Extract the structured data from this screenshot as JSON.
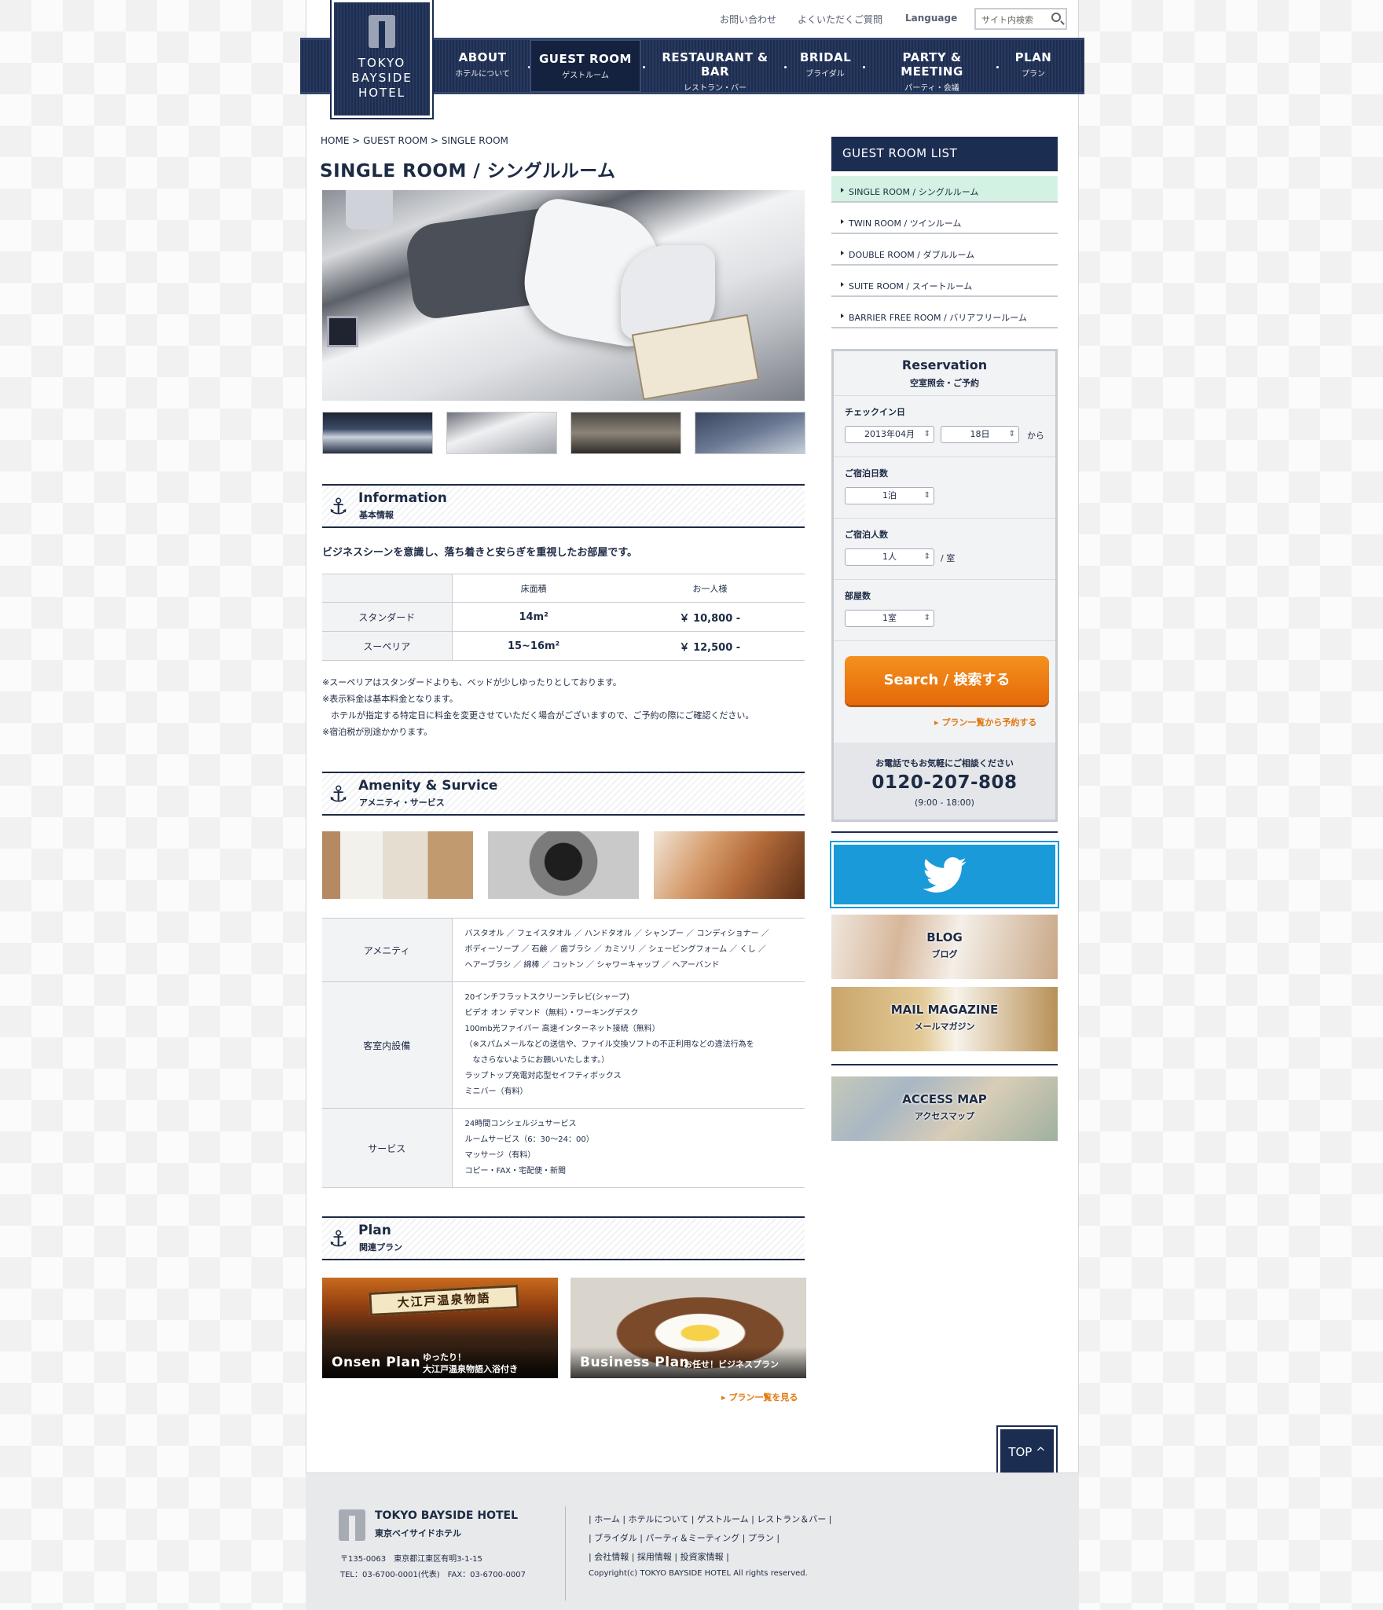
{
  "header": {
    "logo_lines": [
      "TOKYO",
      "BAYSIDE",
      "HOTEL"
    ],
    "top_links": [
      "お問い合わせ",
      "よくいただくご質問",
      "Language"
    ],
    "site_search_placeholder": "サイト内検索",
    "nav": [
      {
        "en": "ABOUT",
        "jp": "ホテルについて"
      },
      {
        "en": "GUEST ROOM",
        "jp": "ゲストルーム"
      },
      {
        "en": "RESTAURANT & BAR",
        "jp": "レストラン・バー"
      },
      {
        "en": "BRIDAL",
        "jp": "ブライダル"
      },
      {
        "en": "PARTY & MEETING",
        "jp": "パーティ・会議"
      },
      {
        "en": "PLAN",
        "jp": "プラン"
      }
    ]
  },
  "breadcrumb": "HOME > GUEST ROOM > SINGLE ROOM",
  "page_title": "SINGLE ROOM / シングルルーム",
  "information": {
    "title_en": "Information",
    "title_jp": "基本情報",
    "lead": "ビジネスシーンを意識し、落ち着きと安らぎを重視したお部屋です。",
    "table_headers": [
      "床面積",
      "お一人様"
    ],
    "rows": [
      {
        "name": "スタンダード",
        "area": "14m²",
        "price": "￥ 10,800 -"
      },
      {
        "name": "スーペリア",
        "area": "15~16m²",
        "price": "￥ 12,500 -"
      }
    ],
    "notes": "※スーペリアはスタンダードよりも、ベッドが少しゆったりとしております。\n※表示料金は基本料金となります。\n　ホテルが指定する特定日に料金を変更させていただく場合がございますので、ご予約の際にご確認ください。\n※宿泊税が別途かかります。"
  },
  "amenity": {
    "title_en": "Amenity & Survice",
    "title_jp": "アメニティ・サービス",
    "rows": [
      {
        "label": "アメニティ",
        "value": "バスタオル ／ フェイスタオル ／ ハンドタオル ／ シャンプー ／ コンディショナー ／\nボディーソープ ／ 石鹸 ／ 歯ブラシ ／ カミソリ ／ シェービングフォーム ／ くし ／\nヘアーブラシ ／ 綿棒 ／ コットン ／ シャワーキャップ ／ ヘアーバンド"
      },
      {
        "label": "客室内設備",
        "value": "20インチフラットスクリーンテレビ(シャープ)\nビデオ オン デマンド（無料）・ワーキングデスク\n100mb光ファイバー 高速インターネット接続（無料）\n（※スパムメールなどの送信や、ファイル交換ソフトの不正利用などの違法行為を\n　なさらないようにお願いいたします。）\nラップトップ充電対応型セイフティボックス\nミニバー（有料）"
      },
      {
        "label": "サービス",
        "value": "24時間コンシェルジュサービス\nルームサービス（6：30〜24：00）\nマッサージ（有料）\nコピー・FAX・宅配便・新聞"
      }
    ]
  },
  "plan": {
    "title_en": "Plan",
    "title_jp": "関連プラン",
    "items": [
      {
        "en": "Onsen Plan",
        "jp1": "ゆったり！",
        "jp2": "大江戸温泉物語入浴付き",
        "sign": "大江戸温泉物語"
      },
      {
        "en": "Business Plan",
        "jp1": "お任せ！ビジネスプラン",
        "jp2": ""
      }
    ],
    "more_link": "プラン一覧を見る"
  },
  "sidebar": {
    "list_title": "GUEST ROOM LIST",
    "list": [
      "SINGLE ROOM / シングルルーム",
      "TWIN ROOM / ツインルーム",
      "DOUBLE ROOM / ダブルルーム",
      "SUITE ROOM / スイートルーム",
      "BARRIER FREE ROOM / バリアフリールーム"
    ],
    "reservation": {
      "title": "Reservation",
      "subtitle": "空室照会・ご予約",
      "checkin_label": "チェックイン日",
      "checkin_month": "2013年04月",
      "checkin_day": "18日",
      "from": "から",
      "nights_label": "ご宿泊日数",
      "nights": "1泊",
      "guests_label": "ご宿泊人数",
      "guests": "1人",
      "per_room": "/ 室",
      "rooms_label": "部屋数",
      "rooms": "1室",
      "search_button": "Search / 検索する",
      "plan_link": "プラン一覧から予約する",
      "phone_note": "お電話でもお気軽にご相談ください",
      "phone": "0120-207-808",
      "hours": "(9:00 - 18:00)"
    },
    "banners": [
      {
        "en": "BLOG",
        "jp": "ブログ"
      },
      {
        "en": "MAIL MAGAZINE",
        "jp": "メールマガジン"
      },
      {
        "en": "ACCESS MAP",
        "jp": "アクセスマップ"
      }
    ]
  },
  "top_button": "TOP",
  "footer": {
    "name_en": "TOKYO BAYSIDE HOTEL",
    "name_jp": "東京ベイサイドホテル",
    "address": "〒135-0063　東京都江東区有明3-1-15\nTEL：03-6700-0001(代表)　FAX：03-6700-0007",
    "links1": "| ホーム | ホテルについて | ゲストルーム | レストラン＆バー |",
    "links2": "| ブライダル | パーティ＆ミーティング | プラン |",
    "links3": "| 会社情報 | 採用情報 | 投資家情報 |",
    "copyright": "Copyright(c) TOKYO BAYSIDE HOTEL All rights reserved."
  },
  "colors": {
    "navy": "#1c2d52",
    "orange": "#e97514",
    "twitter": "#1a9ad9",
    "selected": "#d3f2e3"
  }
}
